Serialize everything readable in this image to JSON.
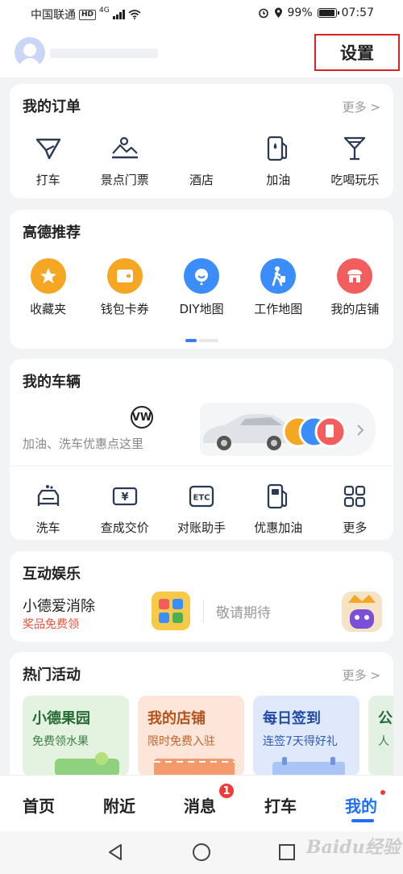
{
  "status_bar": {
    "carrier": "中国联通",
    "network": "HD",
    "signal_label": "4G",
    "battery": "99%",
    "time": "07:57",
    "battery_level": 0.99
  },
  "header": {
    "settings_label": "设置"
  },
  "orders": {
    "title": "我的订单",
    "more": "更多 >",
    "items": [
      {
        "label": "打车",
        "icon": "taxi-icon"
      },
      {
        "label": "景点门票",
        "icon": "scenic-ticket-icon"
      },
      {
        "label": "酒店",
        "icon": "hotel-icon"
      },
      {
        "label": "加油",
        "icon": "fuel-pump-icon"
      },
      {
        "label": "吃喝玩乐",
        "icon": "cocktail-icon"
      }
    ]
  },
  "recommend": {
    "title": "高德推荐",
    "items": [
      {
        "label": "收藏夹",
        "icon": "star-icon",
        "color": "#f5a623"
      },
      {
        "label": "钱包卡券",
        "icon": "wallet-icon",
        "color": "#f5a623"
      },
      {
        "label": "DIY地图",
        "icon": "diy-map-icon",
        "color": "#3a8dfa"
      },
      {
        "label": "工作地图",
        "icon": "walking-person-icon",
        "color": "#3a8dfa"
      },
      {
        "label": "我的店铺",
        "icon": "shop-icon",
        "color": "#f25d5d"
      }
    ]
  },
  "vehicle": {
    "title": "我的车辆",
    "brand_logo": "VW",
    "hint": "加油、洗车优惠点这里",
    "items": [
      {
        "label": "洗车",
        "icon": "car-wash-icon"
      },
      {
        "label": "查成交价",
        "icon": "price-tag-icon"
      },
      {
        "label": "对账助手",
        "icon": "etc-icon"
      },
      {
        "label": "优惠加油",
        "icon": "fuel-pump-icon"
      },
      {
        "label": "更多",
        "icon": "grid-more-icon"
      }
    ]
  },
  "games": {
    "title": "互动娱乐",
    "game_name": "小德爱消除",
    "game_subtitle": "奖品免费领",
    "waiting": "敬请期待"
  },
  "activities": {
    "title": "热门活动",
    "more": "更多 >",
    "tiles": [
      {
        "title": "小德果园",
        "subtitle": "免费领水果"
      },
      {
        "title": "我的店铺",
        "subtitle": "限时免费入驻"
      },
      {
        "title": "每日签到",
        "subtitle": "连签7天得好礼"
      },
      {
        "title": "公",
        "subtitle": "人"
      }
    ]
  },
  "tabs": [
    {
      "label": "首页"
    },
    {
      "label": "附近"
    },
    {
      "label": "消息",
      "badge": "1"
    },
    {
      "label": "打车"
    },
    {
      "label": "我的"
    }
  ],
  "watermark": "Baidu经验"
}
